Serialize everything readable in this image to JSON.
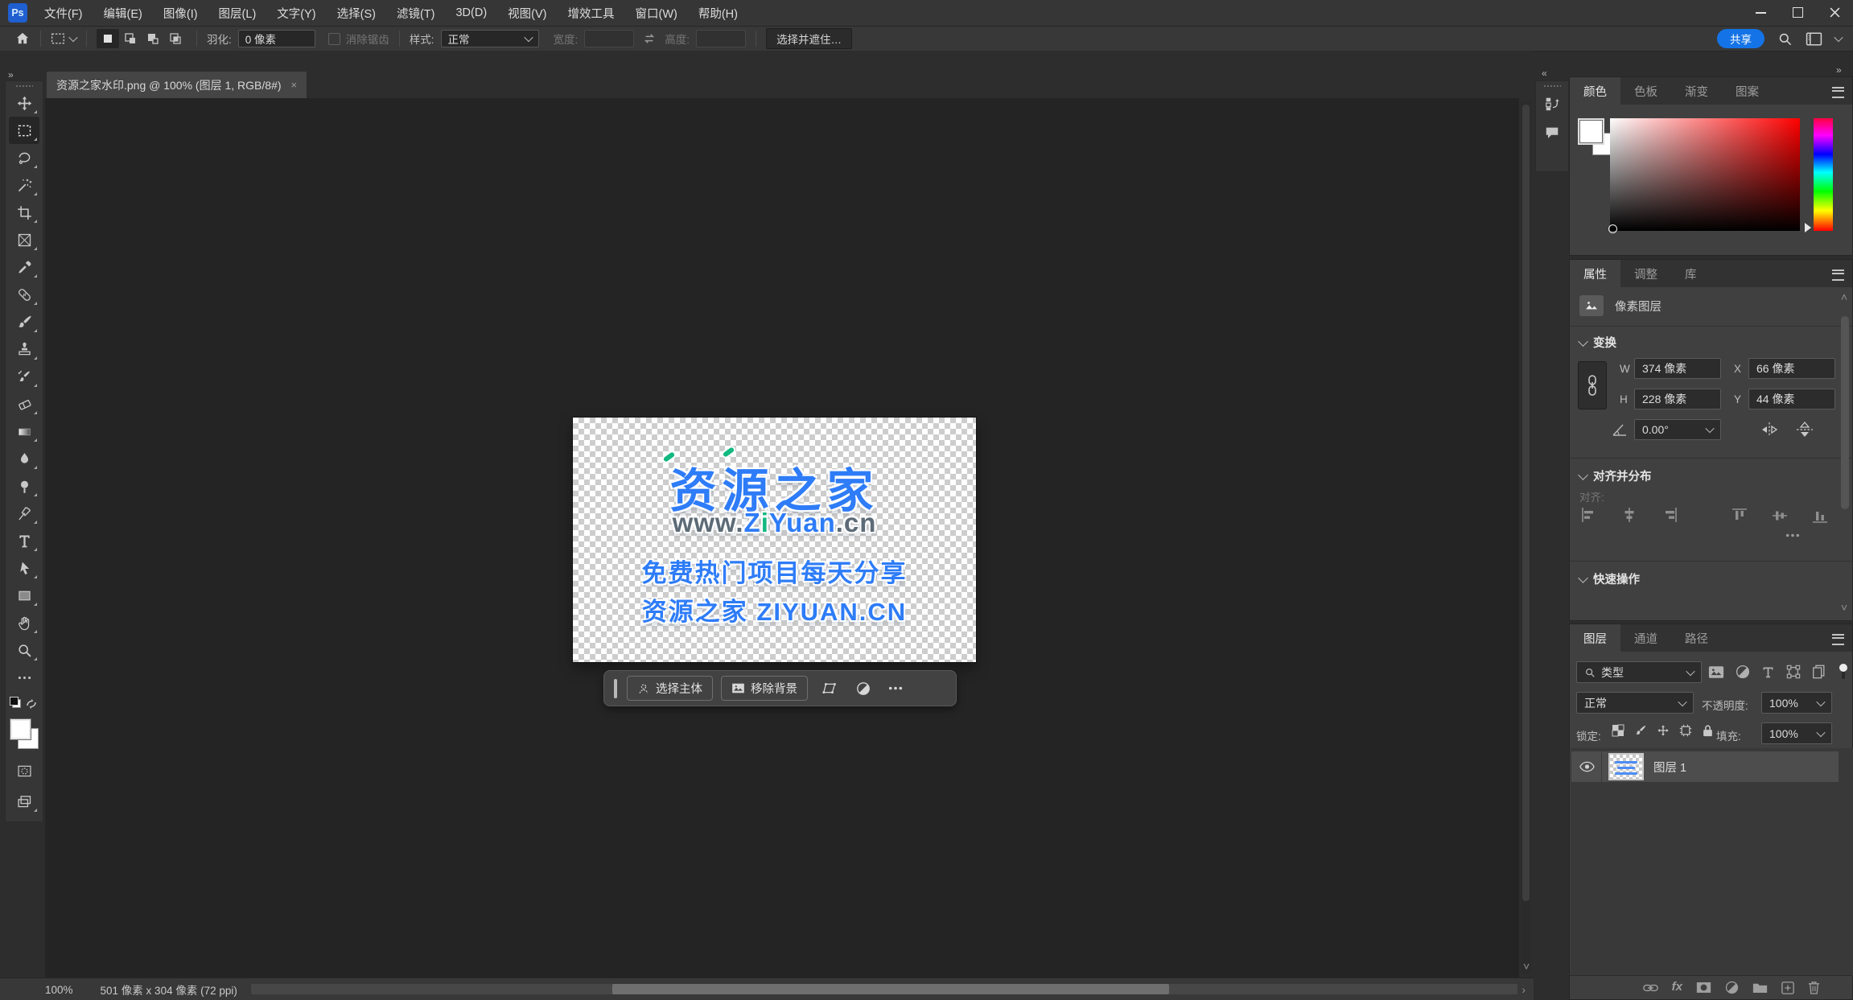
{
  "app": {
    "logo": "Ps"
  },
  "menu_bar": {
    "items": [
      "文件(F)",
      "编辑(E)",
      "图像(I)",
      "图层(L)",
      "文字(Y)",
      "选择(S)",
      "滤镜(T)",
      "3D(D)",
      "视图(V)",
      "增效工具",
      "窗口(W)",
      "帮助(H)"
    ]
  },
  "options_bar": {
    "feather_label": "羽化:",
    "feather_value": "0 像素",
    "antialias_label": "消除锯齿",
    "style_label": "样式:",
    "style_value": "正常",
    "width_label": "宽度:",
    "height_label": "高度:",
    "select_and_mask": "选择并遮住…",
    "share": "共享"
  },
  "document": {
    "tab_title": "资源之家水印.png @ 100% (图层 1, RGB/8#)",
    "close": "×"
  },
  "canvas": {
    "watermark": {
      "title": "资源之家",
      "url_prefix": "www.",
      "url_z": "Z",
      "url_i": "i",
      "url_rest": "Yuan",
      "url_suffix": ".cn",
      "line3": "免费热门项目每天分享",
      "line4": "资源之家 ZIYUAN.CN"
    },
    "taskbar": {
      "select_subject": "选择主体",
      "remove_background": "移除背景"
    }
  },
  "panels": {
    "color": {
      "tabs": [
        "颜色",
        "色板",
        "渐变",
        "图案"
      ]
    },
    "properties": {
      "tabs": [
        "属性",
        "调整",
        "库"
      ],
      "layer_type": "像素图层",
      "transform_title": "变换",
      "w_label": "W",
      "w_value": "374 像素",
      "x_label": "X",
      "x_value": "66 像素",
      "h_label": "H",
      "h_value": "228 像素",
      "y_label": "Y",
      "y_value": "44 像素",
      "angle_value": "0.00°",
      "align_title": "对齐并分布",
      "align_label": "对齐:",
      "quick_actions_title": "快速操作"
    },
    "layers": {
      "tabs": [
        "图层",
        "通道",
        "路径"
      ],
      "filter_type": "类型",
      "blend_mode": "正常",
      "opacity_label": "不透明度:",
      "opacity_value": "100%",
      "lock_label": "锁定:",
      "fill_label": "填充:",
      "fill_value": "100%",
      "fx_label": "fx",
      "rows": [
        {
          "name": "图层 1"
        }
      ]
    }
  },
  "status_bar": {
    "zoom": "100%",
    "doc_size": "501 像素 x 304 像素 (72 ppi)"
  },
  "colors": {
    "accent_blue": "#1473e6",
    "watermark_blue": "#2e7cf7",
    "watermark_green": "#12b981",
    "watermark_gray": "#5d6b77"
  },
  "icons": [
    "ps-logo",
    "home-icon",
    "marquee-preset-icon",
    "new-selection-icon",
    "add-selection-icon",
    "subtract-selection-icon",
    "intersect-selection-icon",
    "swap-dimensions-icon",
    "share-button",
    "search-icon",
    "workspace-icon",
    "move-tool",
    "rectangular-marquee-tool",
    "lasso-tool",
    "object-selection-tool",
    "crop-tool",
    "frame-tool",
    "eyedropper-tool",
    "spot-healing-tool",
    "brush-tool",
    "clone-stamp-tool",
    "history-brush-tool",
    "eraser-tool",
    "gradient-tool",
    "blur-tool",
    "dodge-tool",
    "pen-tool",
    "type-tool",
    "path-selection-tool",
    "rectangle-tool",
    "hand-tool",
    "zoom-tool",
    "history-panel-icon",
    "comment-panel-icon",
    "link-icon",
    "flip-horizontal-icon",
    "flip-vertical-icon",
    "eye-icon",
    "fx-icon",
    "mask-icon",
    "adjustment-icon",
    "folder-icon",
    "new-layer-icon",
    "trash-icon"
  ]
}
